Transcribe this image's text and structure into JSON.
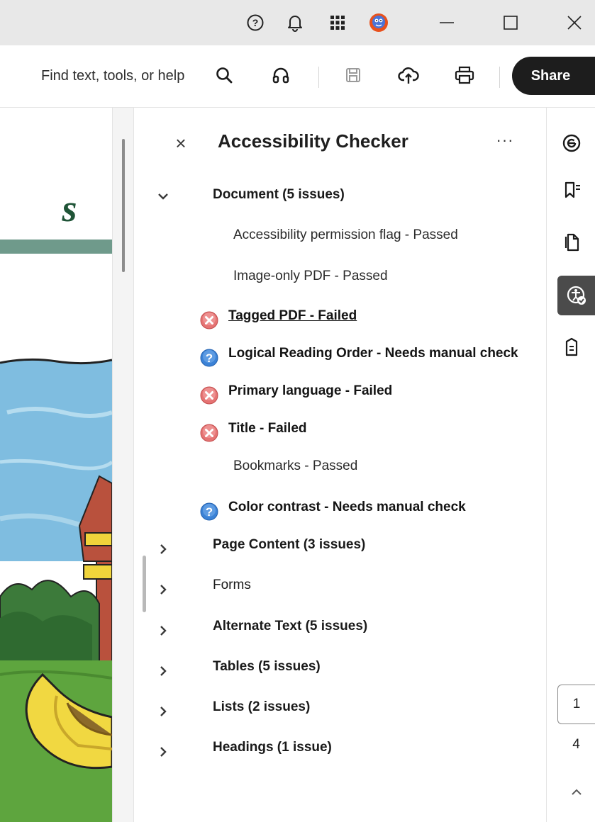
{
  "titlebar": {
    "help_icon": "question-circle-icon",
    "notifications_icon": "bell-icon",
    "apps_icon": "grid-icon",
    "avatar_icon": "avatar-icon",
    "minimize_icon": "minimize-icon",
    "maximize_icon": "maximize-icon",
    "close_icon": "close-icon"
  },
  "toolbar": {
    "search_placeholder": "Find text, tools, or help",
    "share_label": "Share",
    "icons": [
      "search-icon",
      "headphones-icon",
      "save-icon",
      "upload-cloud-icon",
      "print-icon"
    ]
  },
  "document": {
    "title_letter": "s"
  },
  "panel": {
    "title": "Accessibility Checker",
    "close_glyph": "×",
    "more_glyph": "···",
    "document_section": {
      "label": "Document (5 issues)",
      "items": [
        {
          "label": "Accessibility permission flag - Passed",
          "status": "passed"
        },
        {
          "label": "Image-only PDF - Passed",
          "status": "passed"
        },
        {
          "label": "Tagged PDF - Failed",
          "status": "failed"
        },
        {
          "label": "Logical Reading Order - Needs manual check",
          "status": "manual"
        },
        {
          "label": "Primary language - Failed",
          "status": "failed"
        },
        {
          "label": "Title - Failed",
          "status": "failed"
        },
        {
          "label": "Bookmarks - Passed",
          "status": "passed"
        },
        {
          "label": "Color contrast - Needs manual check",
          "status": "manual"
        }
      ]
    },
    "sections": [
      {
        "label": "Page Content (3 issues)"
      },
      {
        "label": "Forms"
      },
      {
        "label": "Alternate Text (5 issues)"
      },
      {
        "label": "Tables (5 issues)"
      },
      {
        "label": "Lists (2 issues)"
      },
      {
        "label": "Headings (1 issue)"
      }
    ]
  },
  "rail": {
    "icons": [
      "comment-icon",
      "bookmarks-icon",
      "pages-icon",
      "accessibility-icon",
      "document-tag-icon"
    ],
    "current_page": "1",
    "total_pages": "4"
  },
  "colors": {
    "failed": "#e57373",
    "manual": "#3b82d6",
    "share_bg": "#1d1d1d",
    "active_rail": "#4b4b4b"
  }
}
